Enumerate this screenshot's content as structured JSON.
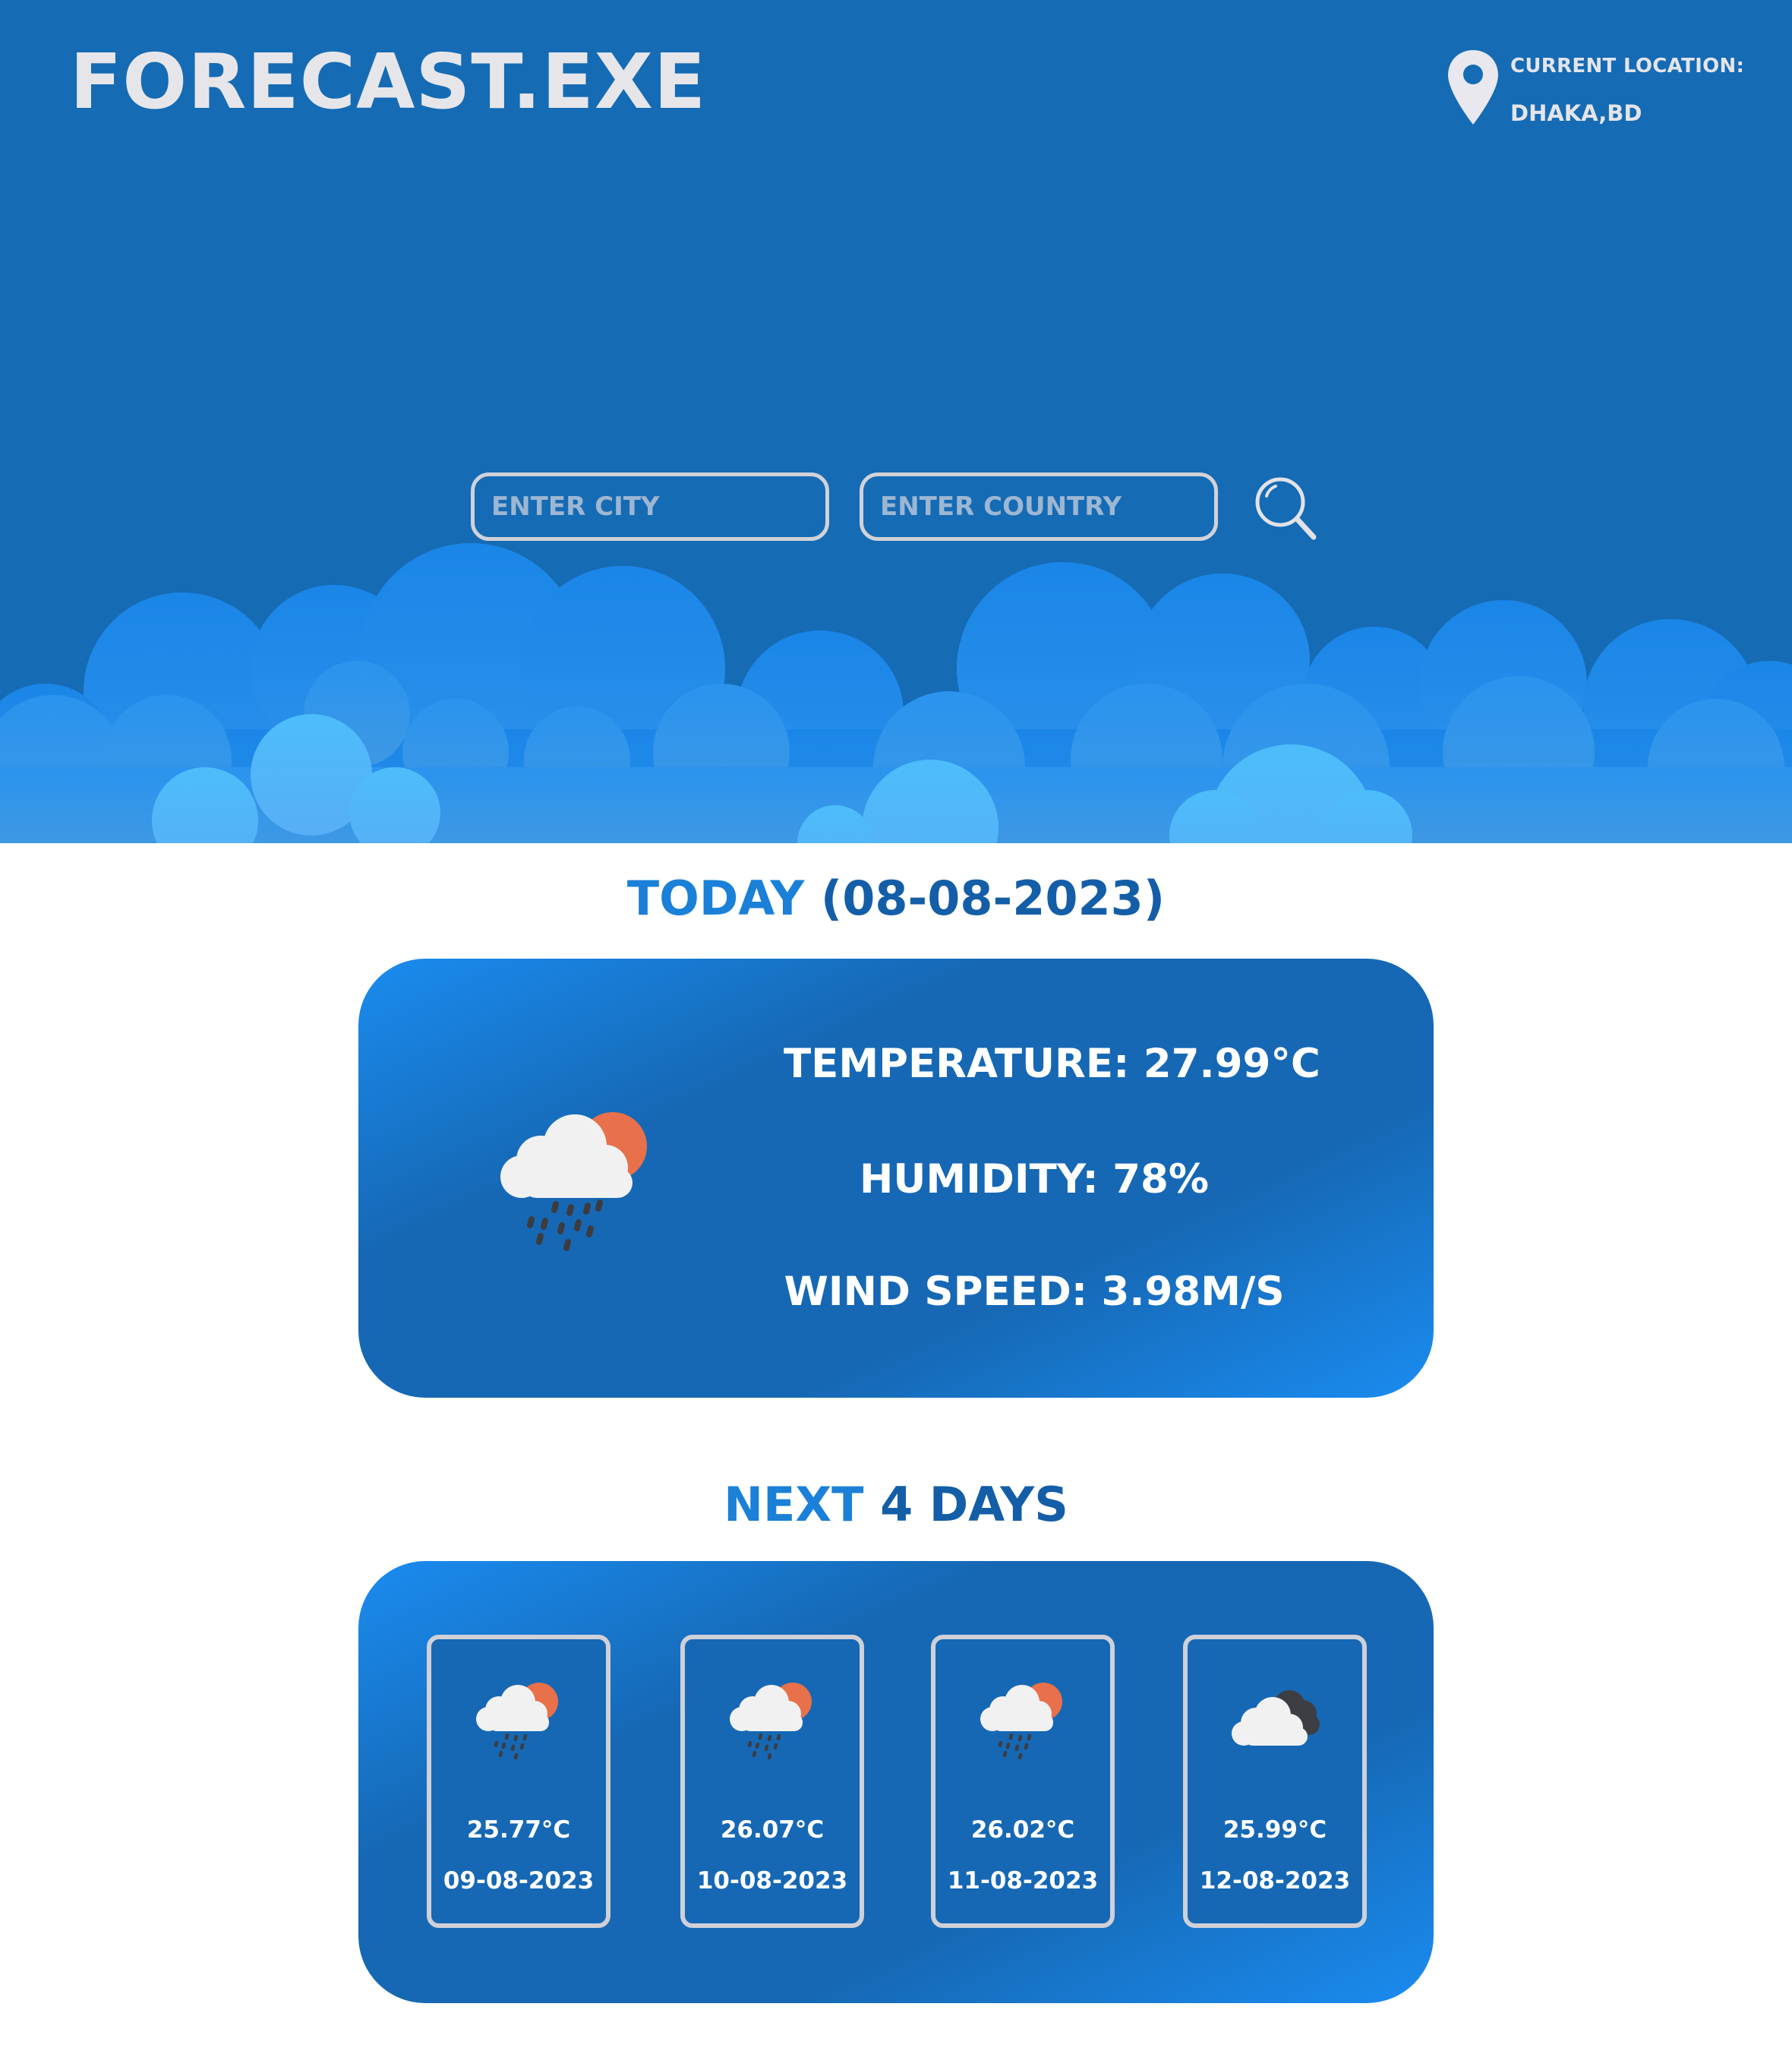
{
  "header": {
    "app_title": "FORECAST.EXE",
    "location_label": "CURRENT LOCATION:",
    "location_value": "DHAKA,BD"
  },
  "search": {
    "city_placeholder": "ENTER CITY",
    "city_value": "",
    "country_placeholder": "ENTER COUNTRY",
    "country_value": ""
  },
  "today": {
    "title_word": "TODAY",
    "title_date": "(08-08-2023)",
    "temperature": "TEMPERATURE: 27.99°C",
    "humidity": "HUMIDITY: 78%",
    "wind_speed": "WIND SPEED: 3.98M/S",
    "icon": "rain-sun-icon"
  },
  "forecast": {
    "title_word": "NEXT",
    "title_rest": "4 DAYS",
    "days": [
      {
        "temp": "25.77°C",
        "date": "09-08-2023",
        "icon": "rain-sun-icon"
      },
      {
        "temp": "26.07°C",
        "date": "10-08-2023",
        "icon": "rain-sun-icon"
      },
      {
        "temp": "26.02°C",
        "date": "11-08-2023",
        "icon": "rain-sun-icon"
      },
      {
        "temp": "25.99°C",
        "date": "12-08-2023",
        "icon": "cloudy-icon"
      }
    ]
  },
  "colors": {
    "hero_background": "#156bb4",
    "title_text": "#e6e6ea",
    "heading_accent": "#1b80d8",
    "heading_dark": "#145ea8",
    "card_gradient_light": "#1a8cf0",
    "card_gradient_dark": "#1668b4",
    "sun": "#e8704a"
  }
}
